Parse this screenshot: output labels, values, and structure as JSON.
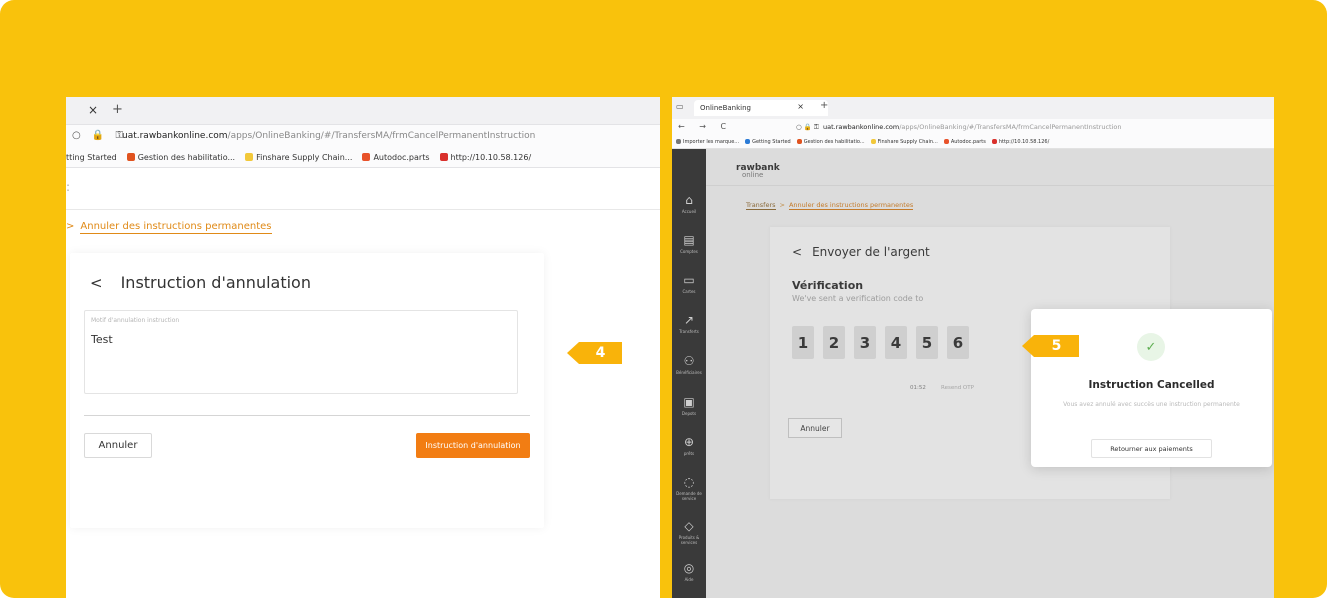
{
  "left": {
    "browser": {
      "tab_close": "×",
      "tab_new": "+",
      "url_host": "uat.rawbankonline.com",
      "url_path": "/apps/OnlineBanking/#/TransfersMA/frmCancelPermanentInstruction",
      "bookmarks": [
        "tting Started",
        "Gestion des habilitatio...",
        "Finshare Supply Chain...",
        "Autodoc.parts",
        "http://10.10.58.126/"
      ]
    },
    "breadcrumb_link": "Annuler des instructions permanentes",
    "card": {
      "back": "<",
      "title": "Instruction d'annulation",
      "field_label": "Motif d'annulation instruction",
      "field_value": "Test",
      "cancel_label": "Annuler",
      "submit_label": "Instruction d'annulation"
    }
  },
  "steps": {
    "step4": "4",
    "step5": "5"
  },
  "right": {
    "browser": {
      "tab_title": "OnlineBanking",
      "tab_close": "×",
      "tab_new": "+",
      "url_host": "uat.rawbankonline.com",
      "url_path": "/apps/OnlineBanking/#/TransfersMA/frmCancelPermanentInstruction",
      "bookmarks": [
        "Importer les marque...",
        "Getting Started",
        "Gestion des habilitatio...",
        "Finshare Supply Chain...",
        "Autodoc.parts",
        "http://10.10.58.126/"
      ]
    },
    "logo": {
      "line1": "rawbank",
      "line2": "online"
    },
    "sidebar": [
      {
        "icon": "⌂",
        "label": "Accueil"
      },
      {
        "icon": "▤",
        "label": "Comptes"
      },
      {
        "icon": "▭",
        "label": "Cartes"
      },
      {
        "icon": "↗",
        "label": "Transferts"
      },
      {
        "icon": "⚇",
        "label": "Bénéficiaires"
      },
      {
        "icon": "▣",
        "label": "Depots"
      },
      {
        "icon": "⊕",
        "label": "prêts"
      },
      {
        "icon": "◌",
        "label": "Demande de service"
      },
      {
        "icon": "◇",
        "label": "Produits & services"
      },
      {
        "icon": "◎",
        "label": "Aide"
      }
    ],
    "breadcrumb": {
      "root": "Transfers",
      "sep": ">",
      "current": "Annuler des instructions permanentes"
    },
    "card": {
      "back": "<",
      "title": "Envoyer de l'argent",
      "verif_title": "Vérification",
      "verif_sub": "We've sent a verification code to",
      "otp": [
        "1",
        "2",
        "3",
        "4",
        "5",
        "6"
      ],
      "timer": "01:52",
      "resend": "Resend OTP",
      "cancel_label": "Annuler"
    },
    "modal": {
      "check": "✓",
      "title": "Instruction Cancelled",
      "description": "Vous avez annulé avec succès une instruction permanente",
      "button": "Retourner aux paiements"
    }
  }
}
